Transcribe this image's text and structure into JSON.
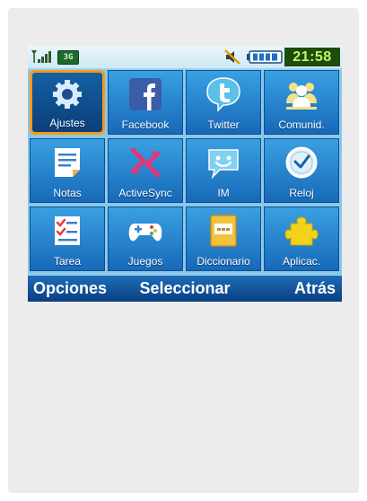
{
  "status_bar": {
    "network": "3G",
    "time": "21:58",
    "icons": [
      "signal-icon",
      "network-3g-icon",
      "mute-icon",
      "battery-icon"
    ]
  },
  "apps": [
    {
      "label": "Ajustes",
      "icon": "gear-icon",
      "selected": true
    },
    {
      "label": "Facebook",
      "icon": "facebook-icon",
      "selected": false
    },
    {
      "label": "Twitter",
      "icon": "twitter-icon",
      "selected": false
    },
    {
      "label": "Comunid.",
      "icon": "community-icon",
      "selected": false
    },
    {
      "label": "Notas",
      "icon": "notes-icon",
      "selected": false
    },
    {
      "label": "ActiveSync",
      "icon": "activesync-icon",
      "selected": false
    },
    {
      "label": "IM",
      "icon": "chat-icon",
      "selected": false
    },
    {
      "label": "Reloj",
      "icon": "clock-icon",
      "selected": false
    },
    {
      "label": "Tarea",
      "icon": "task-icon",
      "selected": false
    },
    {
      "label": "Juegos",
      "icon": "gamepad-icon",
      "selected": false
    },
    {
      "label": "Diccionario",
      "icon": "dictionary-icon",
      "selected": false
    },
    {
      "label": "Aplicac.",
      "icon": "puzzle-icon",
      "selected": false
    }
  ],
  "softkeys": {
    "left": "Opciones",
    "center": "Seleccionar",
    "right": "Atrás"
  },
  "colors": {
    "selection_outline": "#f39a1a",
    "tile_blue": "#1769b8",
    "clock_bg": "#1c4d0d",
    "clock_text": "#c8f26a"
  }
}
